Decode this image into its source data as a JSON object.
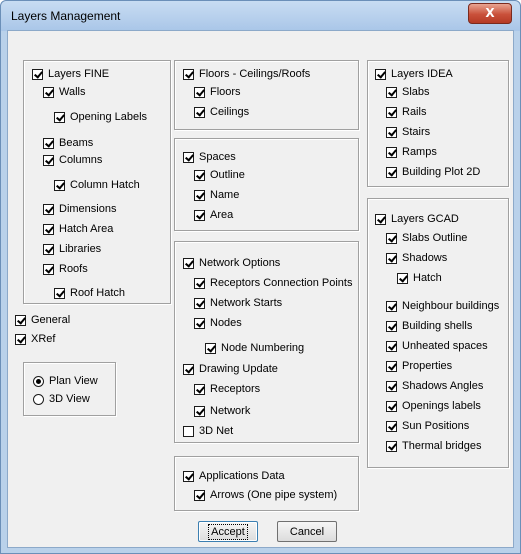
{
  "window": {
    "title": "Layers Management",
    "close_label": "X"
  },
  "fine": {
    "layers_fine": "Layers FINE",
    "walls": "Walls",
    "opening_labels": "Opening Labels",
    "beams": "Beams",
    "columns": "Columns",
    "column_hatch": "Column Hatch",
    "dimensions": "Dimensions",
    "hatch_area": "Hatch Area",
    "libraries": "Libraries",
    "roofs": "Roofs",
    "roof_hatch": "Roof Hatch"
  },
  "general": "General",
  "xref": "XRef",
  "view": {
    "plan_view": "Plan View",
    "view_3d": "3D View",
    "selected": "plan_view"
  },
  "floors": {
    "title": "Floors - Ceilings/Roofs",
    "floors": "Floors",
    "ceilings": "Ceilings"
  },
  "spaces": {
    "title": "Spaces",
    "outline": "Outline",
    "name": "Name",
    "area": "Area"
  },
  "network": {
    "title": "Network Options",
    "receptors_connection_points": "Receptors Connection Points",
    "network_starts": "Network Starts",
    "nodes": "Nodes",
    "node_numbering": "Node Numbering",
    "drawing_update": "Drawing Update",
    "receptors": "Receptors",
    "network": "Network",
    "net_3d": "3D Net"
  },
  "applications": {
    "title": "Applications Data",
    "arrows": "Arrows (One pipe system)"
  },
  "idea": {
    "title": "Layers IDEA",
    "slabs": "Slabs",
    "rails": "Rails",
    "stairs": "Stairs",
    "ramps": "Ramps",
    "building_plot": "Building Plot 2D"
  },
  "gcad": {
    "title": "Layers GCAD",
    "slabs_outline": "Slabs Outline",
    "shadows": "Shadows",
    "hatch": "Hatch",
    "neighbour_buildings": "Neighbour buildings",
    "building_shells": "Building shells",
    "unheated_spaces": "Unheated spaces",
    "properties": "Properties",
    "shadows_angles": "Shadows Angles",
    "openings_labels": "Openings labels",
    "sun_positions": "Sun Positions",
    "thermal_bridges": "Thermal bridges"
  },
  "buttons": {
    "accept": "Accept",
    "cancel": "Cancel"
  }
}
